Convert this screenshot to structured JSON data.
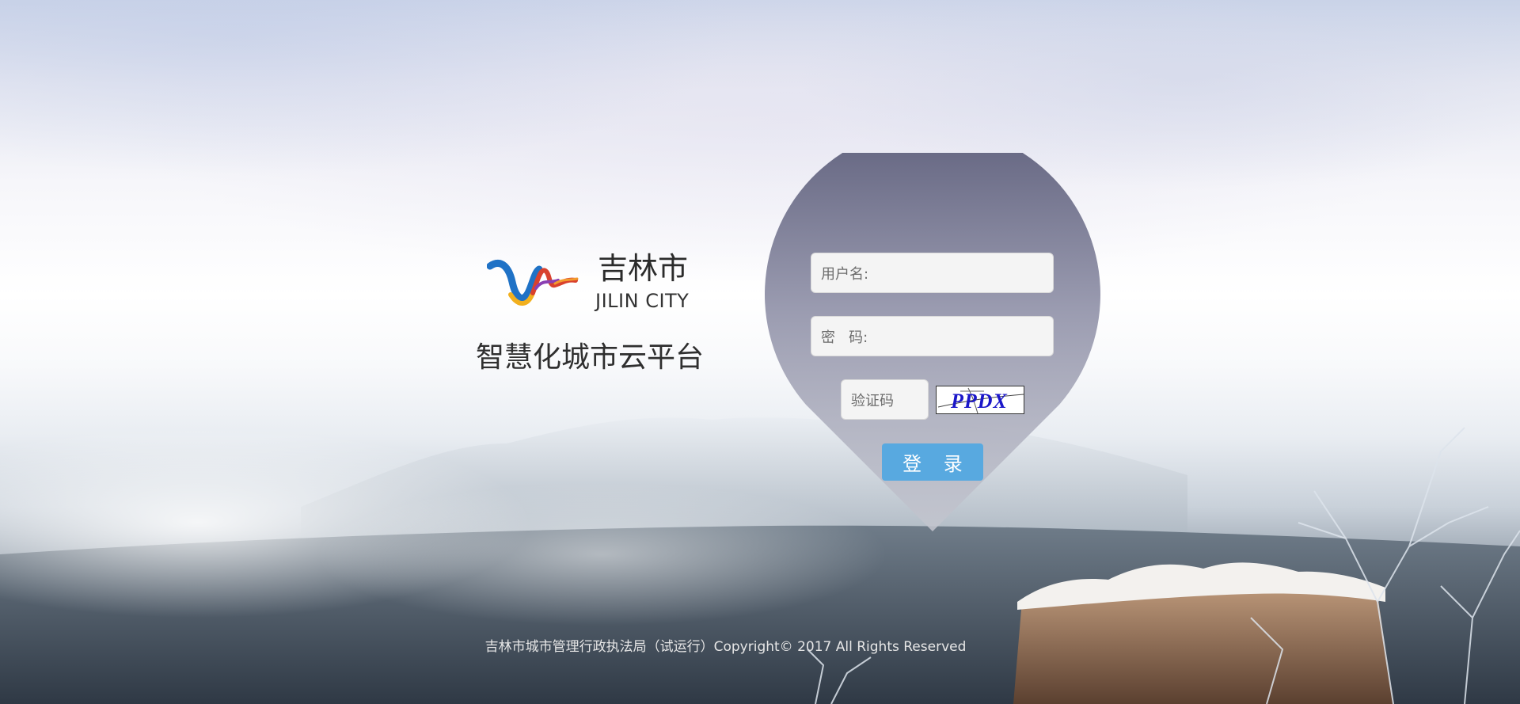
{
  "brand": {
    "city_cn": "吉林市",
    "city_en": "JILIN CITY",
    "platform": "智慧化城市云平台",
    "logo_icon": "jilin-city-ribbon-logo"
  },
  "login_form": {
    "username_label": "用户名:",
    "password_label": "密   码:",
    "captcha_label": "验证码",
    "captcha_code": "PPDX",
    "login_button": "登 录"
  },
  "footer": {
    "text": "吉林市城市管理行政执法局（试运行）Copyright© 2017 All Rights Reserved"
  },
  "colors": {
    "button": "#58a9e0",
    "pin_top": "#62637f",
    "pin_bottom": "#c4c6cf",
    "captcha_text": "#1b17c9"
  }
}
